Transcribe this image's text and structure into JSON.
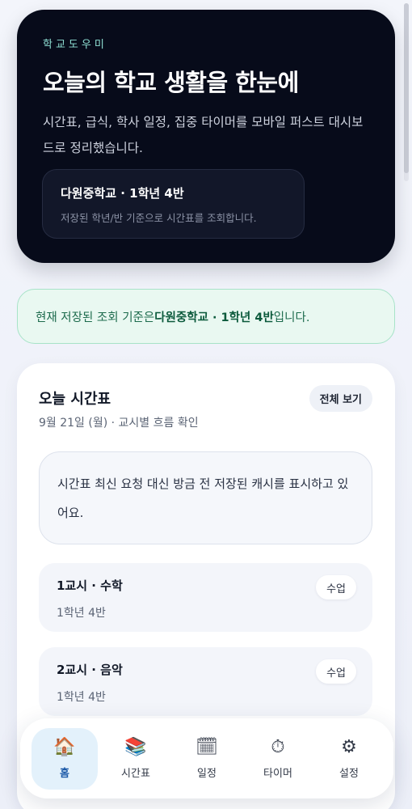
{
  "hero": {
    "eyebrow": "학교도우미",
    "title": "오늘의 학교 생활을 한눈에",
    "description": "시간표, 급식, 학사 일정, 집중 타이머를 모바일 퍼스트 대시보드로 정리했습니다.",
    "chip_title": "다원중학교 · 1학년 4반",
    "chip_subtitle": "저장된 학년/반 기준으로 시간표를 조회합니다."
  },
  "notice": {
    "prefix": "현재 저장된 조회 기준은 ",
    "highlight": "다원중학교 · 1학년 4반",
    "suffix": "입니다."
  },
  "timetable": {
    "title": "오늘 시간표",
    "subtitle": "9월 21일 (월) · 교시별 흐름 확인",
    "view_all_label": "전체 보기",
    "cache_message": "시간표 최신 요청 대신 방금 전 저장된 캐시를 표시하고 있어요.",
    "periods": [
      {
        "title": "1교시 · 수학",
        "class": "1학년 4반",
        "tag": "수업"
      },
      {
        "title": "2교시 · 음악",
        "class": "1학년 4반",
        "tag": "수업"
      }
    ]
  },
  "nav": {
    "items": [
      {
        "label": "홈",
        "icon": "house-icon",
        "glyph": "🏠",
        "active": true
      },
      {
        "label": "시간표",
        "icon": "books-icon",
        "glyph": "📚",
        "active": false
      },
      {
        "label": "일정",
        "icon": "calendar-icon",
        "glyph": "🗓",
        "active": false
      },
      {
        "label": "타이머",
        "icon": "stopwatch-icon",
        "glyph": "⏱",
        "active": false
      },
      {
        "label": "설정",
        "icon": "gear-icon",
        "glyph": "⚙",
        "active": false
      }
    ]
  },
  "colors": {
    "hero_bg": "#070b1a",
    "eyebrow": "#8fe0d4",
    "notice_bg": "#e9f8f1",
    "notice_border": "#a7e3c8",
    "nav_active_bg": "#e3f1fb"
  }
}
